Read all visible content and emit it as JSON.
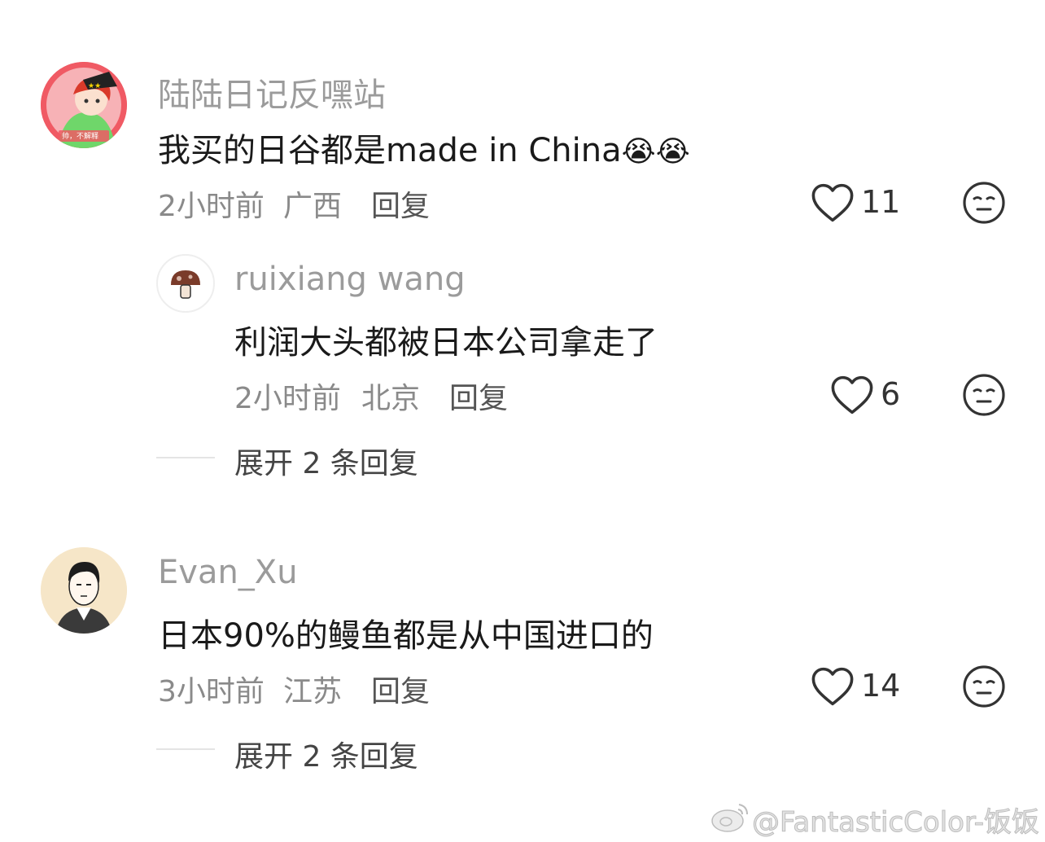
{
  "comments": [
    {
      "username": "陆陆日记反嘿站",
      "text": "我买的日谷都是made in China",
      "emoji": "😭😭",
      "avatar_caption": "帅，不解释",
      "time": "2小时前",
      "location": "广西",
      "reply_label": "回复",
      "likes": "11",
      "replies": [
        {
          "username": "ruixiang wang",
          "text": "利润大头都被日本公司拿走了",
          "time": "2小时前",
          "location": "北京",
          "reply_label": "回复",
          "likes": "6"
        }
      ],
      "expand_label": "展开 2 条回复"
    },
    {
      "username": "Evan_Xu",
      "text": "日本90%的鳗鱼都是从中国进口的",
      "time": "3小时前",
      "location": "江苏",
      "reply_label": "回复",
      "likes": "14",
      "expand_label": "展开 2 条回复"
    }
  ],
  "watermark": "@FantasticColor-饭饭",
  "icons": {
    "like": "heart-outline-icon",
    "dislike": "neutral-face-icon",
    "weibo": "weibo-logo-icon"
  },
  "colors": {
    "avatar1_bg": "#f05a64",
    "username": "#9b9b9b",
    "text": "#1a1a1a"
  }
}
